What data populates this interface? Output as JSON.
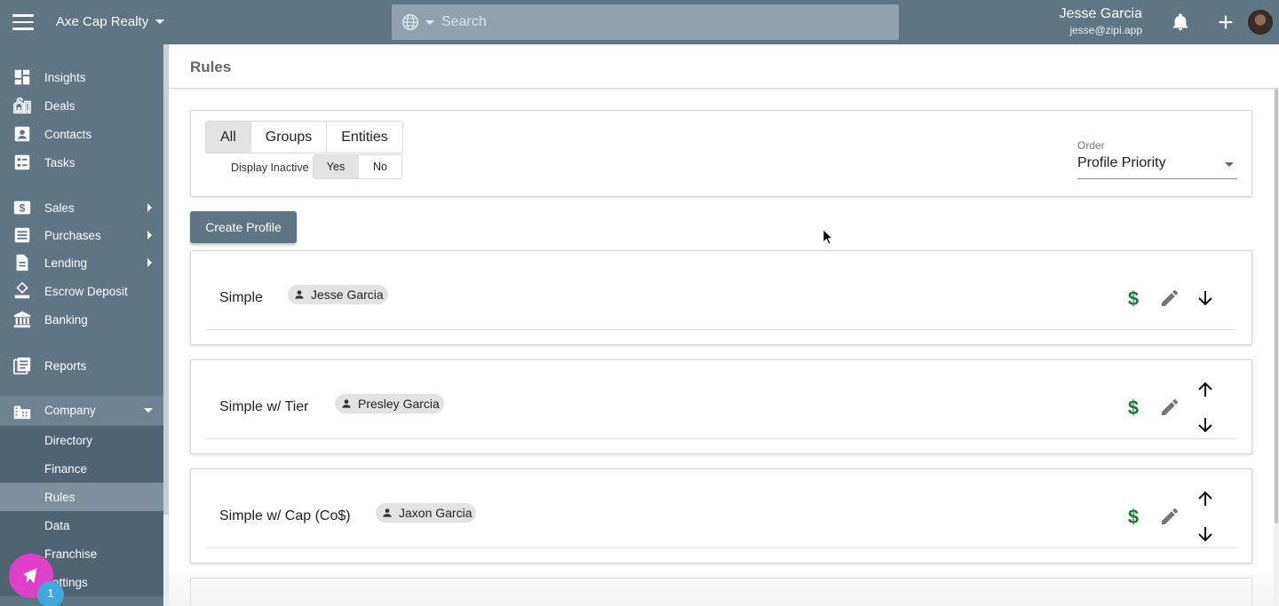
{
  "topbar": {
    "company": "Axe Cap Realty",
    "search_placeholder": "Search",
    "user_name": "Jesse Garcia",
    "user_email": "jesse@zipi.app"
  },
  "sidebar": {
    "items": [
      {
        "label": "Insights",
        "icon": "dashboard-icon"
      },
      {
        "label": "Deals",
        "icon": "building-icon"
      },
      {
        "label": "Contacts",
        "icon": "contact-card-icon"
      },
      {
        "label": "Tasks",
        "icon": "tasks-icon"
      },
      {
        "label": "Sales",
        "icon": "dollar-box-icon"
      },
      {
        "label": "Purchases",
        "icon": "list-icon"
      },
      {
        "label": "Lending",
        "icon": "document-icon"
      },
      {
        "label": "Escrow Deposit",
        "icon": "escrow-icon"
      },
      {
        "label": "Banking",
        "icon": "bank-icon"
      },
      {
        "label": "Reports",
        "icon": "reports-icon"
      },
      {
        "label": "Company",
        "icon": "company-icon"
      }
    ],
    "company_sub": [
      {
        "label": "Directory"
      },
      {
        "label": "Finance"
      },
      {
        "label": "Rules"
      },
      {
        "label": "Data"
      },
      {
        "label": "Franchise"
      },
      {
        "label": "Settings"
      }
    ],
    "active_sub": "Rules",
    "notification_count": "1"
  },
  "page": {
    "title": "Rules"
  },
  "filters": {
    "tabs": [
      {
        "label": "All"
      },
      {
        "label": "Groups"
      },
      {
        "label": "Entities"
      }
    ],
    "active_tab": "All",
    "display_inactive_label": "Display Inactive",
    "display_inactive_options": [
      {
        "label": "Yes"
      },
      {
        "label": "No"
      }
    ],
    "display_inactive_value": "Yes",
    "order_label": "Order",
    "order_value": "Profile Priority"
  },
  "create_button": "Create Profile",
  "rules": [
    {
      "name": "Simple",
      "assignee": "Jesse Garcia",
      "can_move_up": false,
      "can_move_down": true
    },
    {
      "name": "Simple w/ Tier",
      "assignee": "Presley Garcia",
      "can_move_up": true,
      "can_move_down": true
    },
    {
      "name": "Simple w/ Cap (Co$)",
      "assignee": "Jaxon Garcia",
      "can_move_up": true,
      "can_move_down": true
    }
  ],
  "colors": {
    "primary": "#5e7584",
    "dollar": "#1f7a3a",
    "fab": "#e040c9",
    "badge": "#3fa9dd"
  }
}
